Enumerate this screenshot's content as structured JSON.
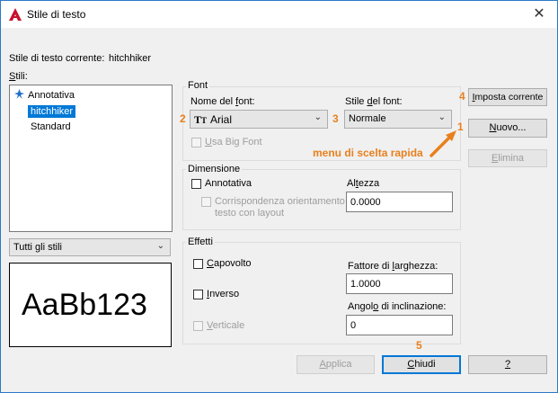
{
  "window": {
    "title": "Stile di testo",
    "close_glyph": "✕",
    "accent_color": "#2b79c9",
    "app_icon": "autocad-icon"
  },
  "current_style": {
    "label": "Stile di testo corrente:",
    "value": "hitchhiker"
  },
  "styles_panel": {
    "label": "Stili:",
    "items": [
      {
        "label": "Annotativa",
        "icon": "annotative-icon",
        "selected": false
      },
      {
        "label": "hitchhiker",
        "selected": true
      },
      {
        "label": "Standard",
        "selected": false
      }
    ],
    "filter": {
      "value": "Tutti gli stili"
    },
    "preview_text": "AaBb123"
  },
  "font_group": {
    "title": "Font",
    "name_label": "Nome del font:",
    "name_value": "Arial",
    "name_icon": "truetype-icon",
    "style_label": "Stile del font:",
    "style_value": "Normale",
    "bigfont_label": "Usa Big Font"
  },
  "size_group": {
    "title": "Dimensione",
    "annotative_label": "Annotativa",
    "orientation_label_1": "Corrispondenza orientamento",
    "orientation_label_2": "testo con layout",
    "height_label": "Altezza",
    "height_value": "0.0000"
  },
  "effects_group": {
    "title": "Effetti",
    "upside_down_label": "Capovolto",
    "backwards_label": "Inverso",
    "vertical_label": "Verticale",
    "width_factor_label": "Fattore di larghezza:",
    "width_factor_value": "1.0000",
    "oblique_label": "Angolo di inclinazione:",
    "oblique_value": "0"
  },
  "buttons": {
    "set_current": "Imposta corrente",
    "new": "Nuovo...",
    "delete": "Elimina",
    "apply": "Applica",
    "close": "Chiudi",
    "help": "?"
  },
  "annotations": {
    "color": "#e8801e",
    "n1": "1",
    "n2": "2",
    "n3": "3",
    "n4": "4",
    "n5": "5",
    "context_menu_label": "menu di scelta rapida"
  }
}
